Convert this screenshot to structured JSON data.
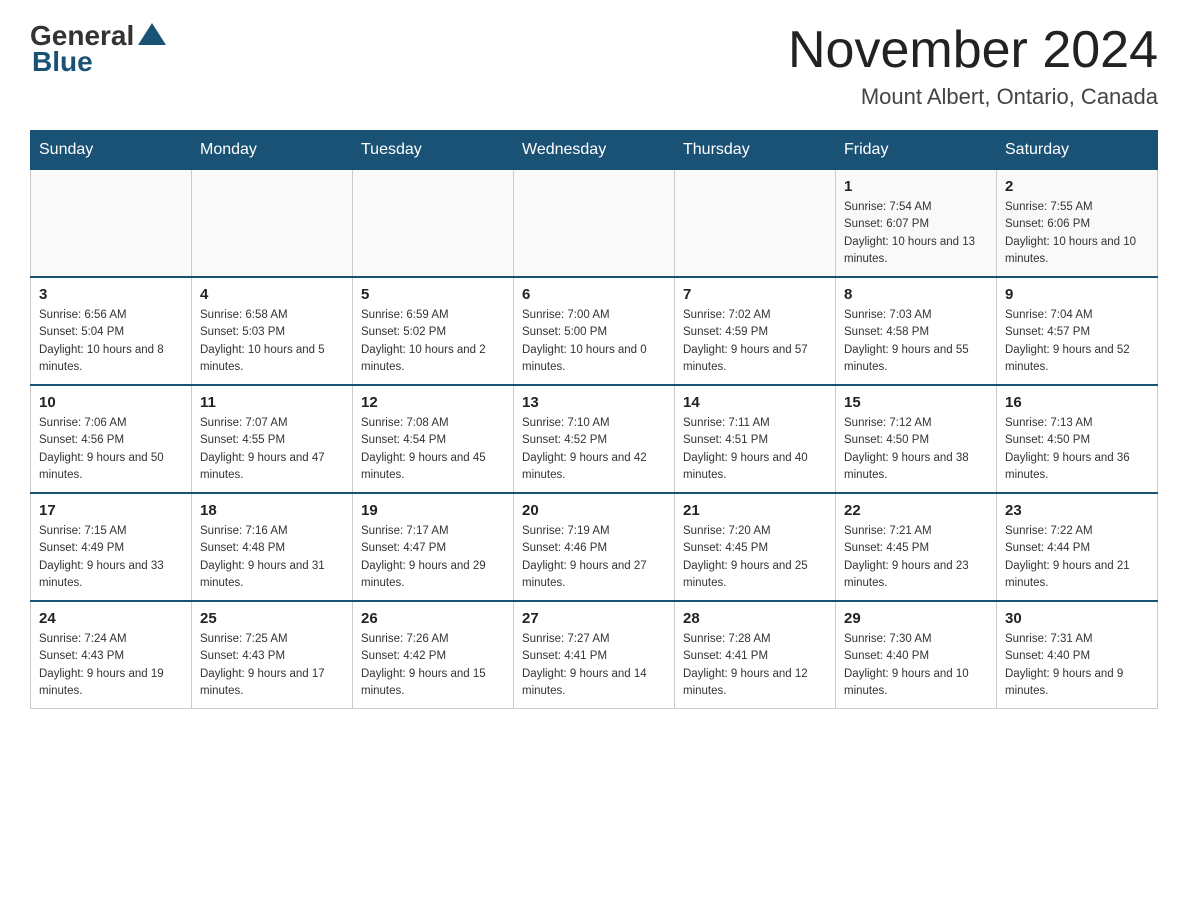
{
  "header": {
    "logo_general": "General",
    "logo_blue": "Blue",
    "month_year": "November 2024",
    "location": "Mount Albert, Ontario, Canada"
  },
  "days_of_week": [
    "Sunday",
    "Monday",
    "Tuesday",
    "Wednesday",
    "Thursday",
    "Friday",
    "Saturday"
  ],
  "weeks": [
    [
      {
        "day": "",
        "sunrise": "",
        "sunset": "",
        "daylight": ""
      },
      {
        "day": "",
        "sunrise": "",
        "sunset": "",
        "daylight": ""
      },
      {
        "day": "",
        "sunrise": "",
        "sunset": "",
        "daylight": ""
      },
      {
        "day": "",
        "sunrise": "",
        "sunset": "",
        "daylight": ""
      },
      {
        "day": "",
        "sunrise": "",
        "sunset": "",
        "daylight": ""
      },
      {
        "day": "1",
        "sunrise": "Sunrise: 7:54 AM",
        "sunset": "Sunset: 6:07 PM",
        "daylight": "Daylight: 10 hours and 13 minutes."
      },
      {
        "day": "2",
        "sunrise": "Sunrise: 7:55 AM",
        "sunset": "Sunset: 6:06 PM",
        "daylight": "Daylight: 10 hours and 10 minutes."
      }
    ],
    [
      {
        "day": "3",
        "sunrise": "Sunrise: 6:56 AM",
        "sunset": "Sunset: 5:04 PM",
        "daylight": "Daylight: 10 hours and 8 minutes."
      },
      {
        "day": "4",
        "sunrise": "Sunrise: 6:58 AM",
        "sunset": "Sunset: 5:03 PM",
        "daylight": "Daylight: 10 hours and 5 minutes."
      },
      {
        "day": "5",
        "sunrise": "Sunrise: 6:59 AM",
        "sunset": "Sunset: 5:02 PM",
        "daylight": "Daylight: 10 hours and 2 minutes."
      },
      {
        "day": "6",
        "sunrise": "Sunrise: 7:00 AM",
        "sunset": "Sunset: 5:00 PM",
        "daylight": "Daylight: 10 hours and 0 minutes."
      },
      {
        "day": "7",
        "sunrise": "Sunrise: 7:02 AM",
        "sunset": "Sunset: 4:59 PM",
        "daylight": "Daylight: 9 hours and 57 minutes."
      },
      {
        "day": "8",
        "sunrise": "Sunrise: 7:03 AM",
        "sunset": "Sunset: 4:58 PM",
        "daylight": "Daylight: 9 hours and 55 minutes."
      },
      {
        "day": "9",
        "sunrise": "Sunrise: 7:04 AM",
        "sunset": "Sunset: 4:57 PM",
        "daylight": "Daylight: 9 hours and 52 minutes."
      }
    ],
    [
      {
        "day": "10",
        "sunrise": "Sunrise: 7:06 AM",
        "sunset": "Sunset: 4:56 PM",
        "daylight": "Daylight: 9 hours and 50 minutes."
      },
      {
        "day": "11",
        "sunrise": "Sunrise: 7:07 AM",
        "sunset": "Sunset: 4:55 PM",
        "daylight": "Daylight: 9 hours and 47 minutes."
      },
      {
        "day": "12",
        "sunrise": "Sunrise: 7:08 AM",
        "sunset": "Sunset: 4:54 PM",
        "daylight": "Daylight: 9 hours and 45 minutes."
      },
      {
        "day": "13",
        "sunrise": "Sunrise: 7:10 AM",
        "sunset": "Sunset: 4:52 PM",
        "daylight": "Daylight: 9 hours and 42 minutes."
      },
      {
        "day": "14",
        "sunrise": "Sunrise: 7:11 AM",
        "sunset": "Sunset: 4:51 PM",
        "daylight": "Daylight: 9 hours and 40 minutes."
      },
      {
        "day": "15",
        "sunrise": "Sunrise: 7:12 AM",
        "sunset": "Sunset: 4:50 PM",
        "daylight": "Daylight: 9 hours and 38 minutes."
      },
      {
        "day": "16",
        "sunrise": "Sunrise: 7:13 AM",
        "sunset": "Sunset: 4:50 PM",
        "daylight": "Daylight: 9 hours and 36 minutes."
      }
    ],
    [
      {
        "day": "17",
        "sunrise": "Sunrise: 7:15 AM",
        "sunset": "Sunset: 4:49 PM",
        "daylight": "Daylight: 9 hours and 33 minutes."
      },
      {
        "day": "18",
        "sunrise": "Sunrise: 7:16 AM",
        "sunset": "Sunset: 4:48 PM",
        "daylight": "Daylight: 9 hours and 31 minutes."
      },
      {
        "day": "19",
        "sunrise": "Sunrise: 7:17 AM",
        "sunset": "Sunset: 4:47 PM",
        "daylight": "Daylight: 9 hours and 29 minutes."
      },
      {
        "day": "20",
        "sunrise": "Sunrise: 7:19 AM",
        "sunset": "Sunset: 4:46 PM",
        "daylight": "Daylight: 9 hours and 27 minutes."
      },
      {
        "day": "21",
        "sunrise": "Sunrise: 7:20 AM",
        "sunset": "Sunset: 4:45 PM",
        "daylight": "Daylight: 9 hours and 25 minutes."
      },
      {
        "day": "22",
        "sunrise": "Sunrise: 7:21 AM",
        "sunset": "Sunset: 4:45 PM",
        "daylight": "Daylight: 9 hours and 23 minutes."
      },
      {
        "day": "23",
        "sunrise": "Sunrise: 7:22 AM",
        "sunset": "Sunset: 4:44 PM",
        "daylight": "Daylight: 9 hours and 21 minutes."
      }
    ],
    [
      {
        "day": "24",
        "sunrise": "Sunrise: 7:24 AM",
        "sunset": "Sunset: 4:43 PM",
        "daylight": "Daylight: 9 hours and 19 minutes."
      },
      {
        "day": "25",
        "sunrise": "Sunrise: 7:25 AM",
        "sunset": "Sunset: 4:43 PM",
        "daylight": "Daylight: 9 hours and 17 minutes."
      },
      {
        "day": "26",
        "sunrise": "Sunrise: 7:26 AM",
        "sunset": "Sunset: 4:42 PM",
        "daylight": "Daylight: 9 hours and 15 minutes."
      },
      {
        "day": "27",
        "sunrise": "Sunrise: 7:27 AM",
        "sunset": "Sunset: 4:41 PM",
        "daylight": "Daylight: 9 hours and 14 minutes."
      },
      {
        "day": "28",
        "sunrise": "Sunrise: 7:28 AM",
        "sunset": "Sunset: 4:41 PM",
        "daylight": "Daylight: 9 hours and 12 minutes."
      },
      {
        "day": "29",
        "sunrise": "Sunrise: 7:30 AM",
        "sunset": "Sunset: 4:40 PM",
        "daylight": "Daylight: 9 hours and 10 minutes."
      },
      {
        "day": "30",
        "sunrise": "Sunrise: 7:31 AM",
        "sunset": "Sunset: 4:40 PM",
        "daylight": "Daylight: 9 hours and 9 minutes."
      }
    ]
  ]
}
